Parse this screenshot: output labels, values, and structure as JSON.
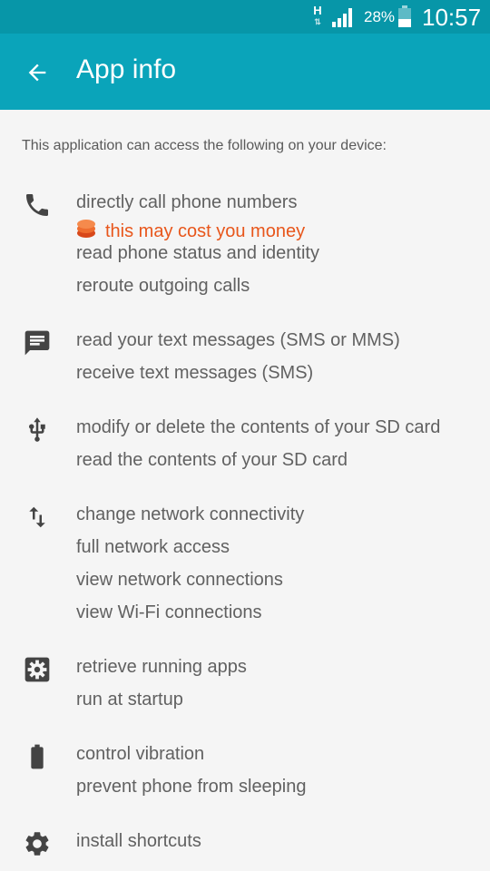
{
  "status_bar": {
    "network_type": "H",
    "battery_percent": "28%",
    "time": "10:57"
  },
  "app_bar": {
    "title": "App info",
    "back_icon": "arrow-back-icon"
  },
  "intro": "This application can access the following on your device:",
  "groups": [
    {
      "icon": "phone-icon",
      "line1": "directly call phone numbers",
      "warning": "this may cost you money",
      "line2": "read phone status and identity",
      "line3": "reroute outgoing calls"
    },
    {
      "icon": "message-icon",
      "line1": "read your text messages (SMS or MMS)",
      "line2": "receive text messages (SMS)"
    },
    {
      "icon": "usb-icon",
      "line1": "modify or delete the contents of your SD card",
      "line2": "read the contents of your SD card"
    },
    {
      "icon": "network-arrows-icon",
      "line1": "change network connectivity",
      "line2": "full network access",
      "line3": "view network connections",
      "line4": "view Wi-Fi connections"
    },
    {
      "icon": "settings-box-icon",
      "line1": "retrieve running apps",
      "line2": "run at startup"
    },
    {
      "icon": "battery-icon",
      "line1": "control vibration",
      "line2": "prevent phone from sleeping"
    },
    {
      "icon": "gear-icon",
      "line1": "install shortcuts"
    }
  ],
  "colors": {
    "status_bar": "#0796a8",
    "app_bar": "#0aa4ba",
    "background": "#f5f5f5",
    "warning": "#e8561b"
  }
}
